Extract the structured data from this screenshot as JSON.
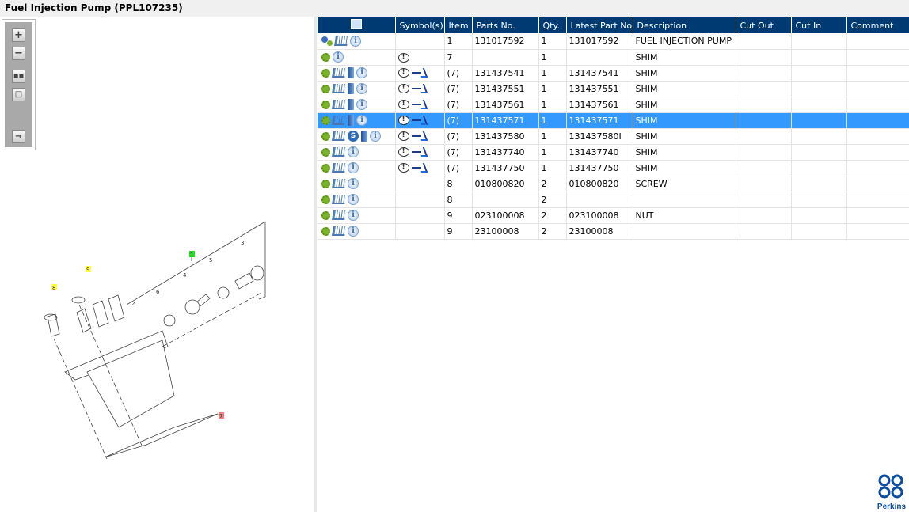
{
  "title": "Fuel Injection Pump (PPL107235)",
  "toolbar": {
    "zoom_in": "+",
    "zoom_out": "−",
    "fit": "fit-icon",
    "actual": "actual-size-icon",
    "export": "export-icon"
  },
  "diagram": {
    "callouts": [
      "1",
      "2",
      "3",
      "4",
      "5",
      "6",
      "7",
      "8",
      "9"
    ],
    "highlight_colors": {
      "green": "#22dd22",
      "yellow": "#ffff33",
      "red": "#f08080"
    }
  },
  "table": {
    "headers": [
      "",
      "Symbol(s)",
      "Item",
      "Parts No.",
      "Qty.",
      "Latest Part No.",
      "Description",
      "Cut Out",
      "Cut In",
      "Comment"
    ],
    "rows": [
      {
        "icons": [
          "gears",
          "cart",
          "info"
        ],
        "symbols": [],
        "item": "1",
        "part": "131017592",
        "qty": "1",
        "latest": "131017592",
        "desc": "FUEL INJECTION PUMP",
        "cut_out": "",
        "cut_in": "",
        "comment": ""
      },
      {
        "icons": [
          "gear",
          "info"
        ],
        "symbols": [
          "note"
        ],
        "item": "7",
        "part": "",
        "qty": "1",
        "latest": "",
        "desc": "SHIM",
        "cut_out": "",
        "cut_in": "",
        "comment": ""
      },
      {
        "icons": [
          "gear",
          "cart",
          "book",
          "info"
        ],
        "symbols": [
          "note",
          "swap"
        ],
        "item": "(7)",
        "part": "131437541",
        "qty": "1",
        "latest": "131437541",
        "desc": "SHIM",
        "cut_out": "",
        "cut_in": "",
        "comment": ""
      },
      {
        "icons": [
          "gear",
          "cart",
          "book",
          "info"
        ],
        "symbols": [
          "note",
          "swap"
        ],
        "item": "(7)",
        "part": "131437551",
        "qty": "1",
        "latest": "131437551",
        "desc": "SHIM",
        "cut_out": "",
        "cut_in": "",
        "comment": ""
      },
      {
        "icons": [
          "gear",
          "cart",
          "book",
          "info"
        ],
        "symbols": [
          "note",
          "swap"
        ],
        "item": "(7)",
        "part": "131437561",
        "qty": "1",
        "latest": "131437561",
        "desc": "SHIM",
        "cut_out": "",
        "cut_in": "",
        "comment": ""
      },
      {
        "icons": [
          "gear",
          "cart",
          "book",
          "info"
        ],
        "symbols": [
          "note",
          "swap"
        ],
        "item": "(7)",
        "part": "131437571",
        "qty": "1",
        "latest": "131437571",
        "desc": "SHIM",
        "cut_out": "",
        "cut_in": "",
        "comment": "",
        "selected": true
      },
      {
        "icons": [
          "gear",
          "cart",
          "s",
          "book",
          "info"
        ],
        "symbols": [
          "note",
          "swap"
        ],
        "item": "(7)",
        "part": "131437580",
        "qty": "1",
        "latest": "131437580I",
        "desc": "SHIM",
        "cut_out": "",
        "cut_in": "",
        "comment": ""
      },
      {
        "icons": [
          "gear",
          "cart",
          "info"
        ],
        "symbols": [
          "note",
          "swap"
        ],
        "item": "(7)",
        "part": "131437740",
        "qty": "1",
        "latest": "131437740",
        "desc": "SHIM",
        "cut_out": "",
        "cut_in": "",
        "comment": ""
      },
      {
        "icons": [
          "gear",
          "cart",
          "info"
        ],
        "symbols": [
          "note",
          "swap"
        ],
        "item": "(7)",
        "part": "131437750",
        "qty": "1",
        "latest": "131437750",
        "desc": "SHIM",
        "cut_out": "",
        "cut_in": "",
        "comment": ""
      },
      {
        "icons": [
          "gear",
          "cart",
          "info"
        ],
        "symbols": [],
        "item": "8",
        "part": "010800820",
        "qty": "2",
        "latest": "010800820",
        "desc": "SCREW",
        "cut_out": "",
        "cut_in": "",
        "comment": ""
      },
      {
        "icons": [
          "gear",
          "cart",
          "info"
        ],
        "symbols": [],
        "item": "8",
        "part": "",
        "qty": "2",
        "latest": "",
        "desc": "",
        "cut_out": "",
        "cut_in": "",
        "comment": ""
      },
      {
        "icons": [
          "gear",
          "cart",
          "info"
        ],
        "symbols": [],
        "item": "9",
        "part": "023100008",
        "qty": "2",
        "latest": "023100008",
        "desc": "NUT",
        "cut_out": "",
        "cut_in": "",
        "comment": ""
      },
      {
        "icons": [
          "gear",
          "cart",
          "info"
        ],
        "symbols": [],
        "item": "9",
        "part": "23100008",
        "qty": "2",
        "latest": "23100008",
        "desc": "",
        "cut_out": "",
        "cut_in": "",
        "comment": ""
      }
    ]
  },
  "logo": {
    "text": "Perkins",
    "color": "#0a4da2"
  },
  "colors": {
    "header": "#003a73",
    "selected": "#3399ff"
  }
}
